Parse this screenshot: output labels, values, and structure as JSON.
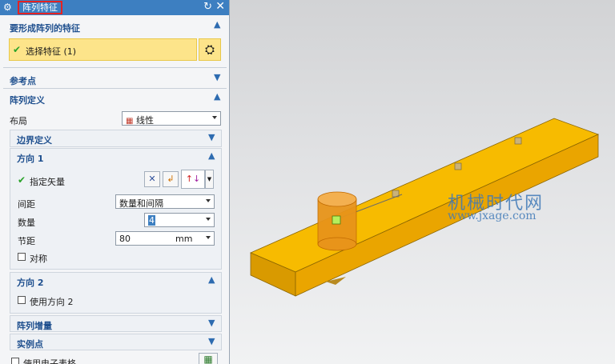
{
  "dialog": {
    "title": "阵列特征",
    "icons": {
      "settings": "gear-icon",
      "reset": "reset-icon",
      "close": "close-icon"
    }
  },
  "sections": {
    "select_features": {
      "title": "要形成阵列的特征",
      "item_label": "选择特征 (1)"
    },
    "reference_point": {
      "title": "参考点"
    },
    "array_definition": {
      "title": "阵列定义",
      "layout_label": "布局",
      "layout_value": "线性",
      "boundary_title": "边界定义",
      "direction1": {
        "title": "方向 1",
        "specify_vector_label": "指定矢量",
        "spacing_label": "间距",
        "spacing_value": "数量和间隔",
        "count_label": "数量",
        "count_value": "4",
        "pitch_label": "节距",
        "pitch_value": "80",
        "pitch_unit": "mm",
        "symmetric_label": "对称"
      },
      "direction2": {
        "title": "方向 2",
        "use_dir2_label": "使用方向 2"
      },
      "increment_title": "阵列增量",
      "instance_title": "实例点",
      "spreadsheet_label": "使用电子表格"
    }
  },
  "viewport": {
    "watermark_cn": "机械时代网",
    "watermark_url": "www.jxage.com",
    "colors": {
      "plate": "#f5b800",
      "cylinder": "#e8941a",
      "edge": "#9a6a00"
    }
  }
}
